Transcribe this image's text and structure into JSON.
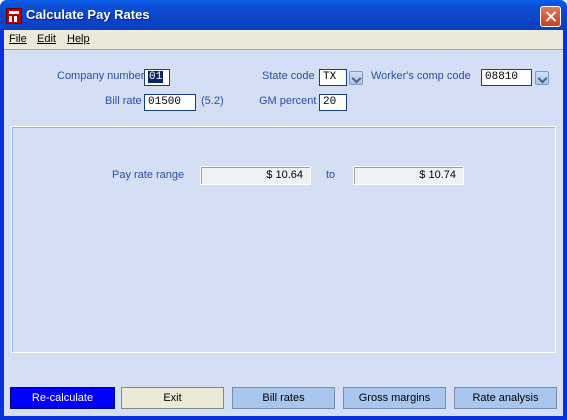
{
  "window": {
    "title": "Calculate Pay Rates"
  },
  "menu": {
    "file": "File",
    "edit": "Edit",
    "help": "Help"
  },
  "form": {
    "company_number_label": "Company number",
    "company_number_value": "01",
    "bill_rate_label": "Bill rate",
    "bill_rate_value": "01500",
    "bill_rate_format": "(5.2)",
    "state_code_label": "State code",
    "state_code_value": "TX",
    "gm_percent_label": "GM percent",
    "gm_percent_value": "20",
    "workers_comp_label": "Worker's comp code",
    "workers_comp_value": "08810"
  },
  "range": {
    "label": "Pay rate range",
    "low": "$ 10.64",
    "to_label": "to",
    "high": "$ 10.74"
  },
  "buttons": {
    "recalculate": "Re-calculate",
    "exit": "Exit",
    "bill_rates": "Bill rates",
    "gross_margins": "Gross margins",
    "rate_analysis": "Rate analysis"
  }
}
